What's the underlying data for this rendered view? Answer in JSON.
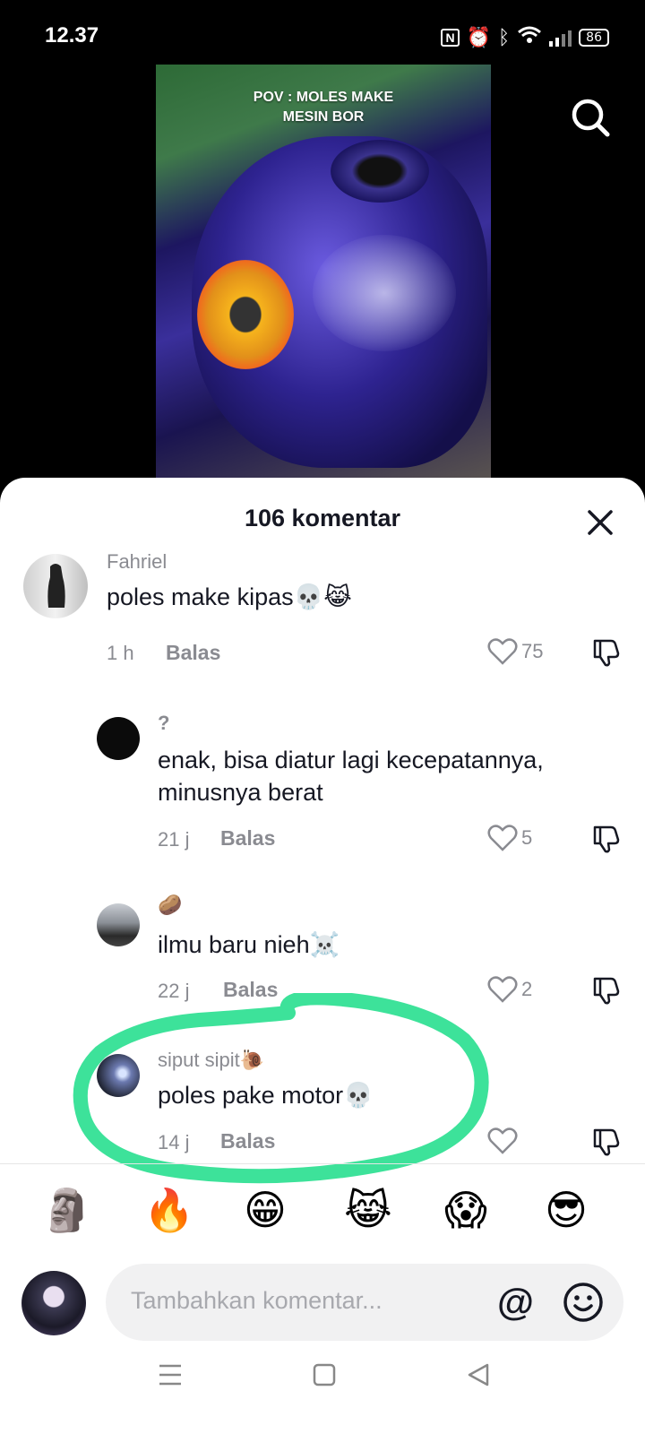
{
  "status_bar": {
    "time": "12.37",
    "battery": "86"
  },
  "video": {
    "overlay_text_line1": "POV : MOLES MAKE",
    "overlay_text_line2": "MESIN BOR"
  },
  "comments_sheet": {
    "title": "106 komentar",
    "comments": [
      {
        "username": "Fahriel",
        "text": "poles make kipas💀😹",
        "time": "1 h",
        "reply": "Balas",
        "likes": "75"
      },
      {
        "username": "?",
        "text_line1": "enak, bisa diatur lagi kecepatannya,",
        "text_line2": "minusnya berat",
        "time": "21 j",
        "reply": "Balas",
        "likes": "5"
      },
      {
        "username": "🥔",
        "text": "ilmu baru nieh☠️",
        "time": "22 j",
        "reply": "Balas",
        "likes": "2"
      },
      {
        "username": "siput sipit🐌",
        "text": "poles pake motor💀",
        "time": "14 j",
        "reply": "Balas",
        "likes": ""
      }
    ]
  },
  "emoji_bar": [
    "🗿",
    "🔥",
    "😁",
    "😹",
    "😱",
    "😎"
  ],
  "input": {
    "placeholder": "Tambahkan komentar...",
    "at_label": "@"
  },
  "colors": {
    "highlight": "#3de29a",
    "text": "#161823",
    "muted": "#8a8b91"
  },
  "icons": [
    "search-icon",
    "close-icon",
    "heart-icon",
    "dislike-icon",
    "emoji-icon",
    "menu-icon",
    "home-icon",
    "back-icon"
  ]
}
